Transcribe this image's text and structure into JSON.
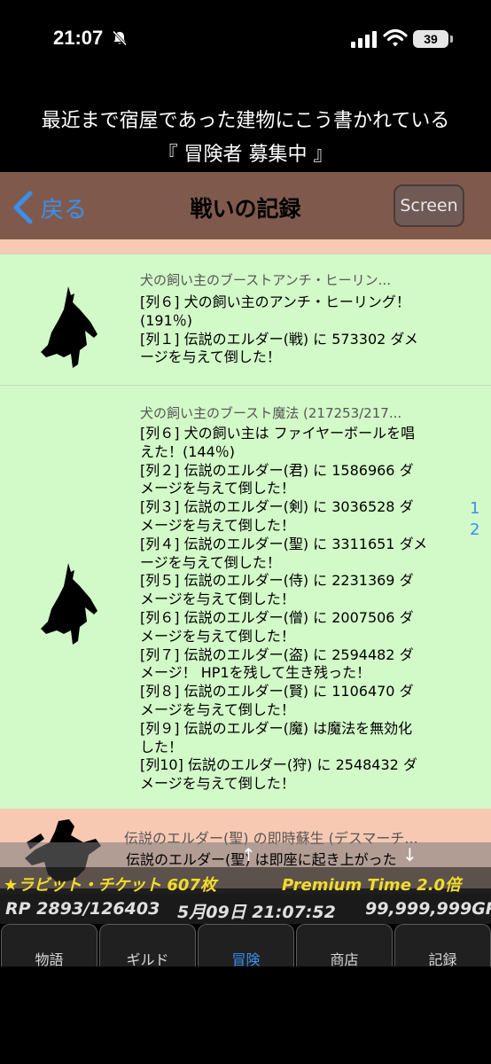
{
  "status_bar": {
    "time": "21:07",
    "battery": "39"
  },
  "story": {
    "line1": "最近まで宿屋であった建物にこう書かれている",
    "line2": "『 冒険者 募集中 』"
  },
  "nav": {
    "back_label": "戻る",
    "title": "戦いの記録",
    "screen_button": "Screen"
  },
  "battle_log": [
    {
      "title": "犬の飼い主のブーストアンチ・ヒーリン...",
      "lines": [
        "[列６] 犬の飼い主のアンチ・ヒーリング！",
        "(191％)",
        "[列１] 伝説のエルダー(戦) に 573302 ダメ",
        "ージを与えて倒した！"
      ]
    },
    {
      "title": "犬の飼い主のブースト魔法 (217253/217...",
      "lines": [
        "[列６] 犬の飼い主は ファイヤーボールを唱",
        "えた！(144％)",
        "[列２] 伝説のエルダー(君) に 1586966 ダ",
        "メージを与えて倒した！",
        "[列３] 伝説のエルダー(剣) に 3036528 ダ",
        "メージを与えて倒した！",
        "[列４] 伝説のエルダー(聖) に 3311651 ダメ",
        "ージを与えて倒した！",
        "[列５] 伝説のエルダー(侍) に 2231369 ダ",
        "メージを与えて倒した！",
        "[列６] 伝説のエルダー(僧) に 2007506 ダ",
        "メージを与えて倒した！",
        "[列７] 伝説のエルダー(盗) に 2594482 ダ",
        "メージ！ HP1を残して生き残った！",
        "[列８] 伝説のエルダー(賢) に 1106470 ダ",
        "メージを与えて倒した！",
        "[列９] 伝説のエルダー(魔) は魔法を無効化",
        "した！",
        "[列10] 伝説のエルダー(狩) に 2548432 ダ",
        "メージを与えて倒した！"
      ]
    },
    {
      "title": "伝説のエルダー(聖) の即時蘇生 (デスマーチ..."
    }
  ],
  "pager": [
    "1",
    "2"
  ],
  "latest_message": "伝説のエルダー(聖) は即座に起き上がった",
  "arrows": {
    "up": "↑",
    "down": "↓"
  },
  "info": {
    "ticket": "★ラビット・チケット 607枚",
    "premium": "Premium Time 2.0倍"
  },
  "stats": {
    "rp": "RP 2893/126403",
    "datetime": "5月09日 21:07:52",
    "gp": "99,999,999GP"
  },
  "tabs": [
    {
      "label": "物語",
      "active": false
    },
    {
      "label": "ギルド",
      "active": false
    },
    {
      "label": "冒険",
      "active": true
    },
    {
      "label": "商店",
      "active": false
    },
    {
      "label": "記録",
      "active": false
    }
  ],
  "colors": {
    "accent": "#3a8ff0",
    "nav_bar": "#7f5a4c",
    "card_green": "#d2f9c8",
    "card_peach": "#f7c9b3",
    "gold_text": "#f2dd2a"
  }
}
